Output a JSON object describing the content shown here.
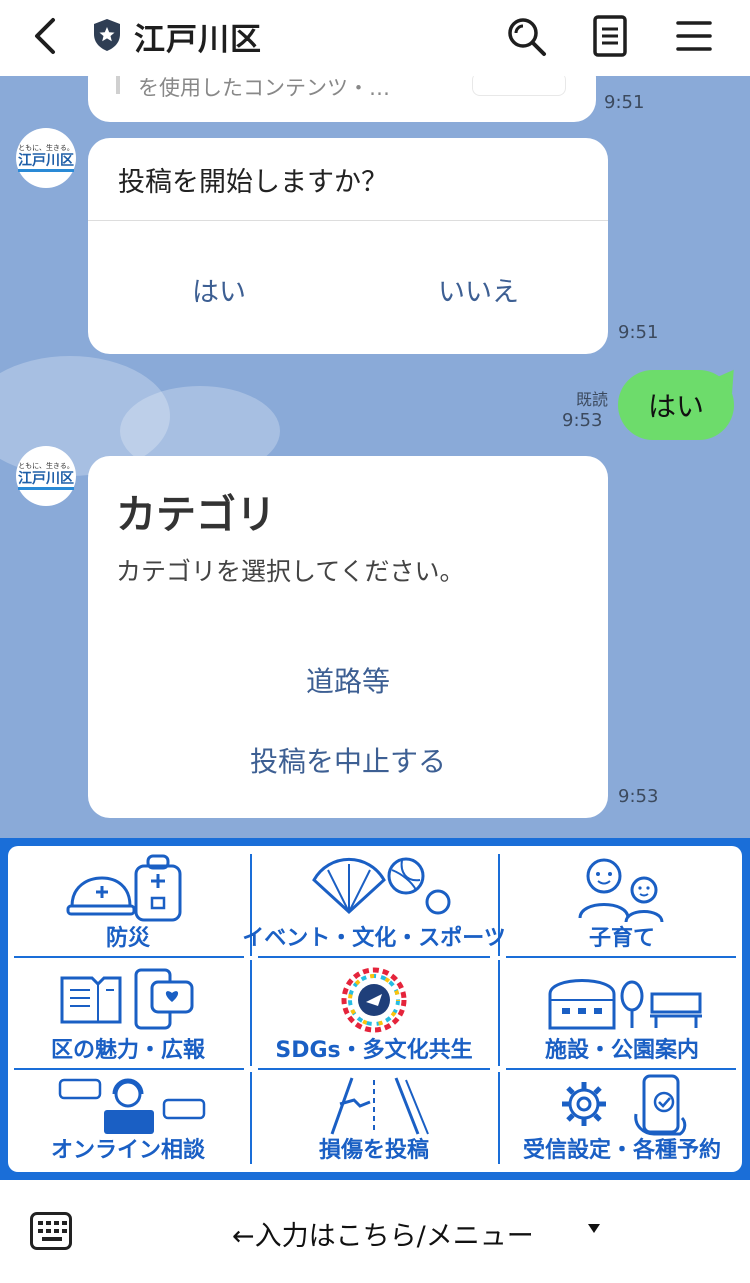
{
  "header": {
    "title": "江戸川区"
  },
  "chat": {
    "messages": [
      {
        "preview_text": "を使用したコンテンツ・…",
        "time": "9:51"
      },
      {
        "question": "投稿を開始しますか？",
        "yes": "はい",
        "no": "いいえ",
        "time": "9:51"
      },
      {
        "user_text": "はい",
        "read_label": "既読",
        "time": "9:53"
      },
      {
        "card_title": "カテゴリ",
        "card_subtitle": "カテゴリを選択してください。",
        "option_1": "道路等",
        "option_2": "投稿を中止する",
        "time": "9:53"
      }
    ],
    "avatar": {
      "tagline": "ともに、生きる。",
      "logo_text": "江戸川区"
    }
  },
  "richmenu": {
    "items": [
      {
        "label": "防災",
        "icon": "helmet-bag-icon"
      },
      {
        "label": "イベント・文化・スポーツ",
        "icon": "fan-ball-icon"
      },
      {
        "label": "子育て",
        "icon": "family-icon"
      },
      {
        "label": "区の魅力・広報",
        "icon": "book-phone-icon"
      },
      {
        "label": "SDGs・多文化共生",
        "icon": "sdgs-wheel-icon"
      },
      {
        "label": "施設・公園案内",
        "icon": "facility-park-icon"
      },
      {
        "label": "オンライン相談",
        "icon": "operator-icon"
      },
      {
        "label": "損傷を投稿",
        "icon": "road-damage-icon"
      },
      {
        "label": "受信設定・各種予約",
        "icon": "gear-phone-icon"
      }
    ]
  },
  "bottom": {
    "input_label": "←入力はこちら/メニュー"
  },
  "colors": {
    "chat_bg": "#8aaad8",
    "menu_blue": "#1a6ed8",
    "user_bubble": "#6ddc6b",
    "link_text": "#3d5f93"
  }
}
